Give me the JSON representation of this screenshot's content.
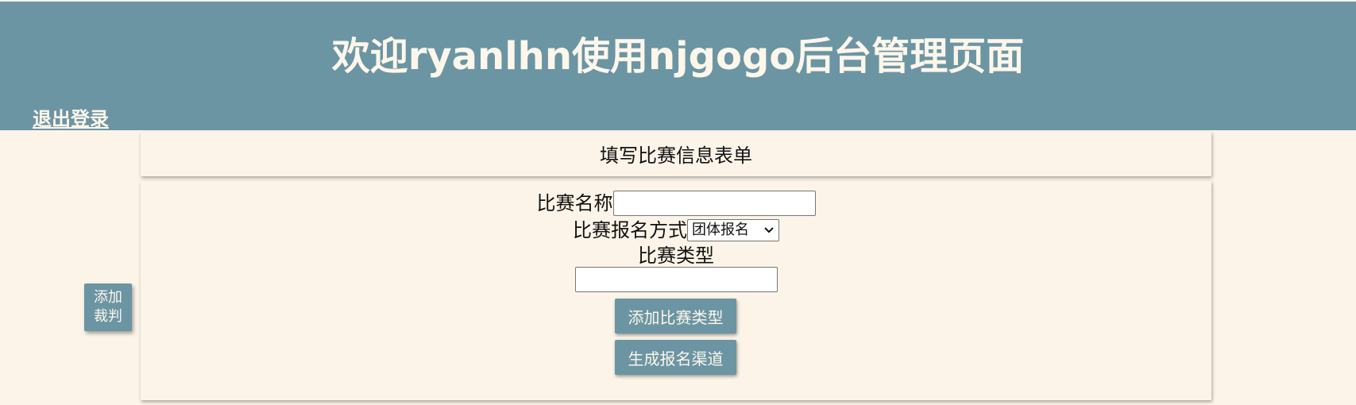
{
  "header": {
    "title": "欢迎ryanlhn使用njgogo后台管理页面",
    "logout_label": "退出登录"
  },
  "sidebar": {
    "add_referee_label": "添加裁判"
  },
  "form": {
    "heading": "填写比赛信息表单",
    "name_label": "比赛名称",
    "name_value": "",
    "signup_mode_label": "比赛报名方式",
    "signup_mode_selected": "团体报名",
    "type_label": "比赛类型",
    "type_value": "",
    "add_type_button": "添加比赛类型",
    "generate_channel_button": "生成报名渠道"
  },
  "colors": {
    "header_bg": "#6b95a3",
    "page_bg": "#fcf4e8",
    "button_bg": "#6b95a3",
    "header_text": "#fdf6ea"
  },
  "icons": {
    "select_chevron": "chevron-down-icon"
  }
}
